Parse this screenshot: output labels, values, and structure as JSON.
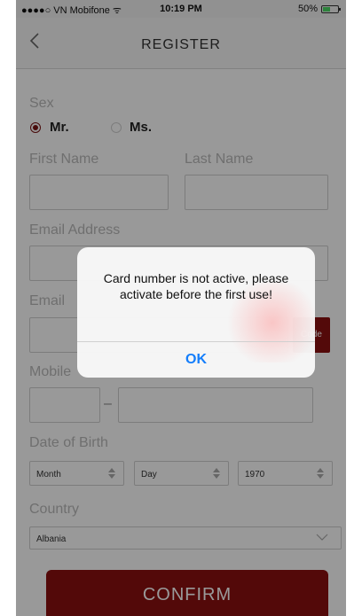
{
  "status_bar": {
    "carrier": "●●●●○ VN Mobifone ᯤ",
    "time": "10:19 PM",
    "battery": "50%",
    "battery_level_pct": 50
  },
  "nav": {
    "title": "REGISTER",
    "back_icon": "chevron-left-icon"
  },
  "form": {
    "sex_label": "Sex",
    "options": {
      "mr": "Mr.",
      "ms": "Ms."
    },
    "selected_sex": "Mr.",
    "first_name_label": "First Name",
    "last_name_label": "Last Name",
    "email_label": "Email Address",
    "email_verify_label": "Email",
    "code_button": "Code",
    "mobile_label": "Mobile",
    "mobile_separator": "–",
    "dob_label": "Date of Birth",
    "month": "Month",
    "day": "Day",
    "year": "1970",
    "country_label": "Country",
    "country": "Albania",
    "confirm": "CONFIRM"
  },
  "alert": {
    "message": "Card number is not active, please activate before the first use!",
    "ok": "OK"
  },
  "colors": {
    "accent": "#8b1010",
    "ios_blue": "#147efb"
  }
}
